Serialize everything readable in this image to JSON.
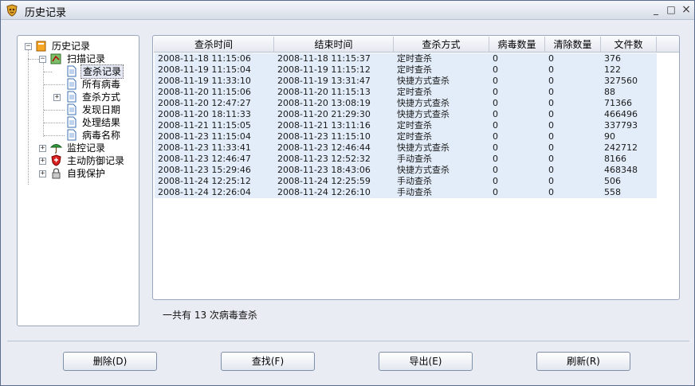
{
  "window": {
    "title": "历史记录",
    "controls": {
      "minimize": "_",
      "maximize": "□",
      "close": "×"
    }
  },
  "tree": {
    "root": "历史记录",
    "scan": {
      "label": "扫描记录",
      "children": [
        "查杀记录",
        "所有病毒",
        "查杀方式",
        "发现日期",
        "处理结果",
        "病毒名称"
      ]
    },
    "others": [
      "监控记录",
      "主动防御记录",
      "自我保护"
    ],
    "expander_plus": "+",
    "expander_minus": "−"
  },
  "table": {
    "columns": [
      "查杀时间",
      "结束时间",
      "查杀方式",
      "病毒数量",
      "清除数量",
      "文件数"
    ],
    "rows": [
      [
        "2008-11-18 11:15:06",
        "2008-11-18 11:15:37",
        "定时查杀",
        "0",
        "0",
        "376"
      ],
      [
        "2008-11-19 11:15:04",
        "2008-11-19 11:15:12",
        "定时查杀",
        "0",
        "0",
        "122"
      ],
      [
        "2008-11-19 11:33:10",
        "2008-11-19 13:31:47",
        "快捷方式查杀",
        "0",
        "0",
        "327560"
      ],
      [
        "2008-11-20 11:15:06",
        "2008-11-20 11:15:13",
        "定时查杀",
        "0",
        "0",
        "88"
      ],
      [
        "2008-11-20 12:47:27",
        "2008-11-20 13:08:19",
        "快捷方式查杀",
        "0",
        "0",
        "71366"
      ],
      [
        "2008-11-20 18:11:33",
        "2008-11-20 21:29:30",
        "快捷方式查杀",
        "0",
        "0",
        "466496"
      ],
      [
        "2008-11-21 11:15:05",
        "2008-11-21 13:11:16",
        "定时查杀",
        "0",
        "0",
        "337793"
      ],
      [
        "2008-11-23 11:15:04",
        "2008-11-23 11:15:10",
        "定时查杀",
        "0",
        "0",
        "90"
      ],
      [
        "2008-11-23 11:33:41",
        "2008-11-23 12:46:44",
        "快捷方式查杀",
        "0",
        "0",
        "242712"
      ],
      [
        "2008-11-23 12:46:47",
        "2008-11-23 12:52:32",
        "手动查杀",
        "0",
        "0",
        "8166"
      ],
      [
        "2008-11-23 15:29:46",
        "2008-11-23 18:43:06",
        "快捷方式查杀",
        "0",
        "0",
        "468348"
      ],
      [
        "2008-11-24 12:25:12",
        "2008-11-24 12:25:59",
        "手动查杀",
        "0",
        "0",
        "506"
      ],
      [
        "2008-11-24 12:26:04",
        "2008-11-24 12:26:10",
        "手动查杀",
        "0",
        "0",
        "558"
      ]
    ]
  },
  "summary": "一共有 13 次病毒查杀",
  "buttons": {
    "delete": "删除(D)",
    "find": "查找(F)",
    "export": "导出(E)",
    "refresh": "刷新(R)"
  },
  "colors": {
    "row_bg": "#e3edf9",
    "accent": "#5a6b8c"
  },
  "icons": {
    "app": "shield-logo-icon",
    "root": "history-book-icon",
    "scan": "scan-record-icon",
    "doc": "document-icon",
    "monitor": "umbrella-icon",
    "defense": "red-shield-icon",
    "self": "lock-icon"
  }
}
